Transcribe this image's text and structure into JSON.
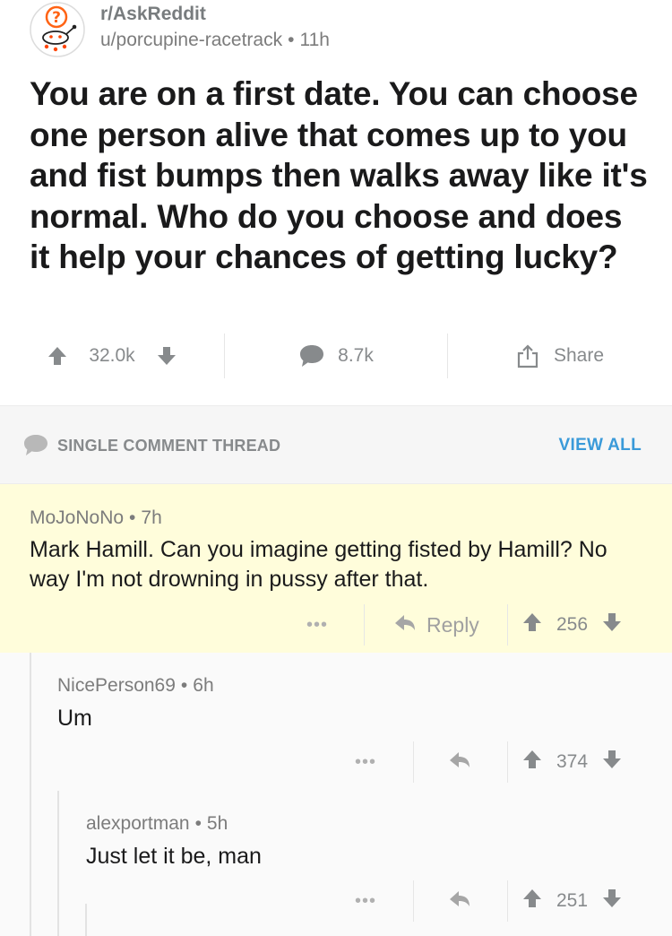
{
  "post": {
    "subreddit": "r/AskReddit",
    "author": "u/porcupine-racetrack",
    "age": "11h",
    "title": "You are on a first date. You can choose one person alive that comes up to you and fist bumps then walks away like it's normal. Who do you choose and does it help your chances of getting lucky?",
    "score": "32.0k",
    "comments": "8.7k",
    "share_label": "Share"
  },
  "thread": {
    "label": "SINGLE COMMENT THREAD",
    "view_all": "VIEW ALL"
  },
  "comments": [
    {
      "author": "MoJoNoNo",
      "age": "7h",
      "body": "Mark Hamill. Can you imagine getting fisted by Hamill? No way I'm not drowning in pussy after that.",
      "more": "•••",
      "reply_label": "Reply",
      "score": "256"
    },
    {
      "author": "NicePerson69",
      "age": "6h",
      "body": "Um",
      "more": "•••",
      "score": "374"
    },
    {
      "author": "alexportman",
      "age": "5h",
      "body": "Just let it be, man",
      "more": "•••",
      "score": "251"
    }
  ],
  "separator": "•",
  "colors": {
    "highlight_background": "#fffddb",
    "thread_banner_background": "#f6f6f6",
    "link_blue": "#3a9ad9",
    "muted_gray": "#878a8c"
  },
  "icons": {
    "subreddit_avatar": "askreddit-snoo-icon",
    "upvote": "arrow-up-icon",
    "downvote": "arrow-down-icon",
    "comments": "speech-bubble-icon",
    "share": "share-upload-icon",
    "reply": "reply-arrow-icon"
  }
}
